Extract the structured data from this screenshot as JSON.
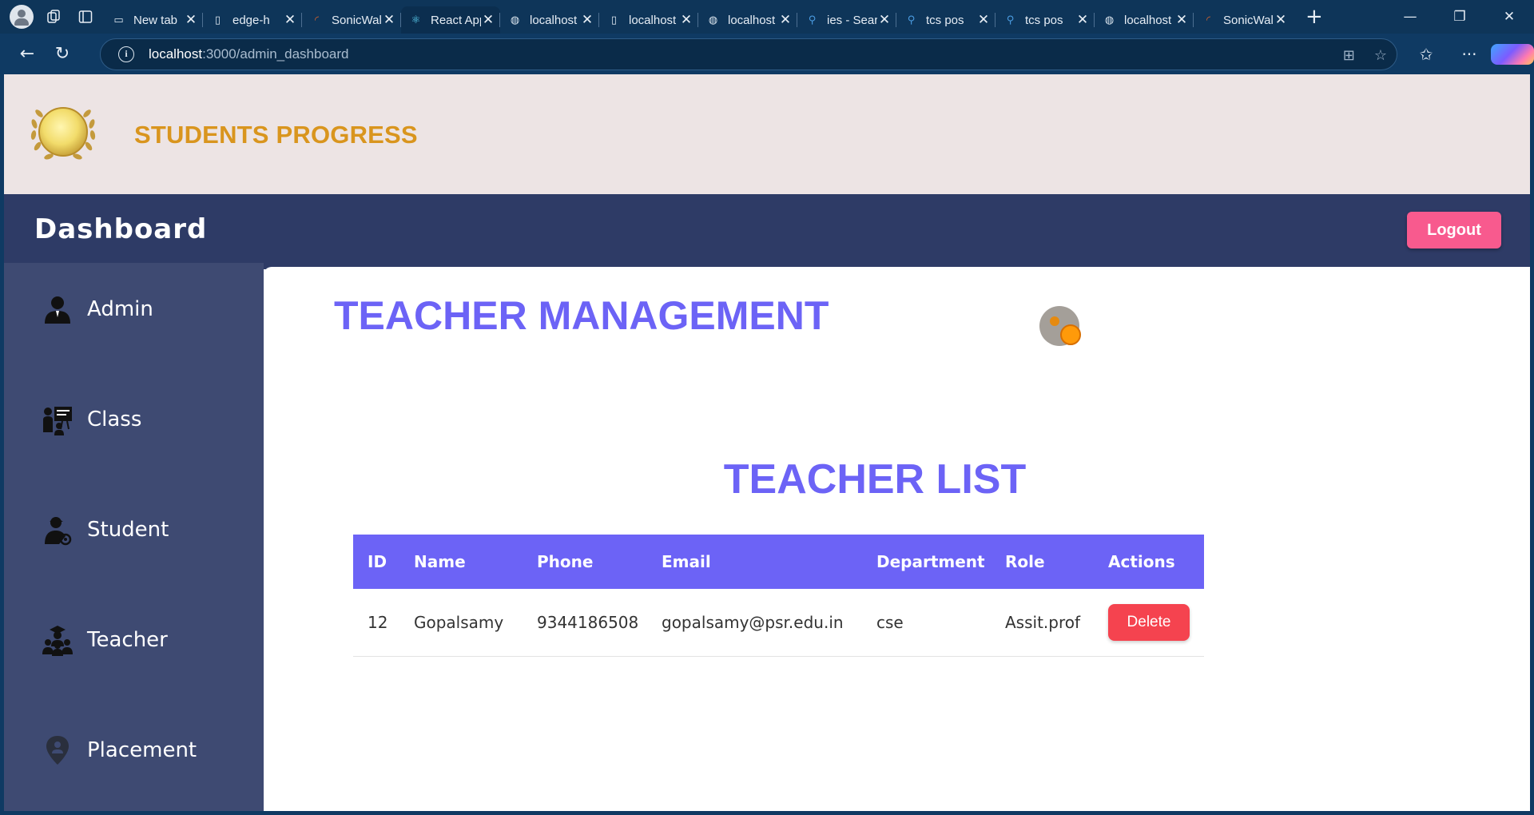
{
  "browser": {
    "tabs": [
      {
        "label": "New tab",
        "icon": "newtab-icon"
      },
      {
        "label": "edge-h",
        "icon": "page-icon"
      },
      {
        "label": "SonicWall",
        "icon": "sonicwall-icon"
      },
      {
        "label": "React App",
        "icon": "react-icon",
        "active": true
      },
      {
        "label": "localhost",
        "icon": "globe-icon"
      },
      {
        "label": "localhost",
        "icon": "page-icon"
      },
      {
        "label": "localhost",
        "icon": "globe-icon"
      },
      {
        "label": "ies - Search",
        "icon": "search-icon"
      },
      {
        "label": "tcs pos",
        "icon": "search-icon"
      },
      {
        "label": "tcs pos",
        "icon": "search-icon"
      },
      {
        "label": "localhost",
        "icon": "globe-icon"
      },
      {
        "label": "SonicWall",
        "icon": "sonicwall-icon"
      }
    ],
    "url_host": "localhost",
    "url_path": ":3000/admin_dashboard"
  },
  "header": {
    "title": "STUDENTS PROGRESS"
  },
  "topbar": {
    "title": "Dashboard",
    "logout_label": "Logout"
  },
  "sidebar": {
    "items": [
      {
        "label": "Admin",
        "icon": "admin-icon"
      },
      {
        "label": "Class",
        "icon": "class-icon"
      },
      {
        "label": "Student",
        "icon": "student-icon"
      },
      {
        "label": "Teacher",
        "icon": "teacher-icon"
      },
      {
        "label": "Placement",
        "icon": "placement-icon"
      }
    ]
  },
  "main": {
    "page_title": "TEACHER MANAGEMENT",
    "list_title": "TEACHER LIST",
    "table": {
      "headers": [
        "ID",
        "Name",
        "Phone",
        "Email",
        "Department",
        "Role",
        "Actions"
      ],
      "rows": [
        {
          "id": "12",
          "name": "Gopalsamy",
          "phone": "9344186508",
          "email": "gopalsamy@psr.edu.in",
          "department": "cse",
          "role": "Assit.prof",
          "action_label": "Delete"
        }
      ]
    }
  },
  "colors": {
    "accent": "#6c63f6",
    "header_title": "#d9951e",
    "nav_bg": "#2e3b66",
    "sidebar_bg": "#3e4a72",
    "logout": "#f85a8e",
    "delete": "#f5434f"
  }
}
